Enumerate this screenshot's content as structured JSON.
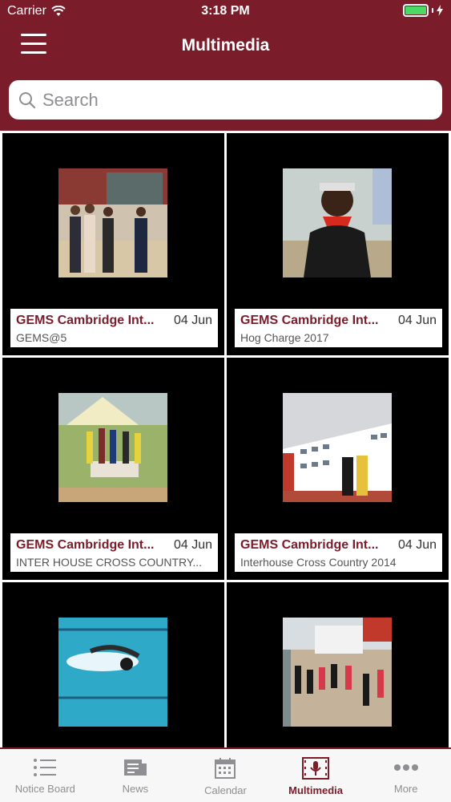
{
  "status_bar": {
    "carrier": "Carrier",
    "time": "3:18 PM"
  },
  "header": {
    "title": "Multimedia"
  },
  "search": {
    "placeholder": "Search"
  },
  "items": [
    {
      "title": "GEMS Cambridge Int...",
      "date": "04 Jun",
      "subtitle": "GEMS@5"
    },
    {
      "title": "GEMS Cambridge Int...",
      "date": "04 Jun",
      "subtitle": "Hog Charge 2017"
    },
    {
      "title": "GEMS Cambridge Int...",
      "date": "04 Jun",
      "subtitle": "INTER HOUSE CROSS COUNTRY..."
    },
    {
      "title": "GEMS Cambridge Int...",
      "date": "04 Jun",
      "subtitle": "Interhouse Cross Country 2014"
    },
    {
      "title": "",
      "date": "",
      "subtitle": ""
    },
    {
      "title": "",
      "date": "",
      "subtitle": ""
    }
  ],
  "tabs": [
    {
      "label": "Notice Board",
      "icon": "list-icon"
    },
    {
      "label": "News",
      "icon": "newspaper-icon"
    },
    {
      "label": "Calendar",
      "icon": "calendar-icon"
    },
    {
      "label": "Multimedia",
      "icon": "microphone-icon",
      "active": true
    },
    {
      "label": "More",
      "icon": "more-icon"
    }
  ],
  "colors": {
    "brand": "#7b1c2a",
    "tab_inactive": "#8e8e93",
    "battery": "#4cd964"
  }
}
